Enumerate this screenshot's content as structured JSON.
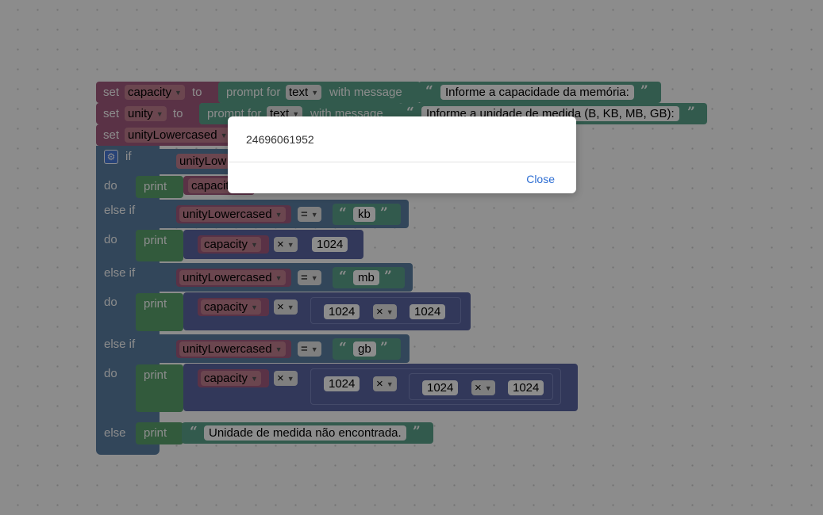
{
  "blocks": {
    "set_kw": "set",
    "to_kw": "to",
    "prompt_for": "prompt for",
    "with_message": "with message",
    "text_type": "text",
    "var_capacity": "capacity",
    "var_unity": "unity",
    "var_unity_lower": "unityLowercased",
    "msg_capacity": "Informe a capacidade da memória:",
    "msg_unity": "Informe a unidade de medida (B, KB, MB, GB):",
    "if_kw": "if",
    "do_kw": "do",
    "else_if_kw": "else if",
    "else_kw": "else",
    "print_kw": "print",
    "eq_op": "=",
    "mul_op": "×",
    "str_kb": "kb",
    "str_mb": "mb",
    "str_gb": "gb",
    "num_1024": "1024",
    "not_found_msg": "Unidade de medida não encontrada.",
    "partial_var1": "unityLow",
    "partial_var2": "capacit",
    "open_quote": "“",
    "close_quote": "”",
    "gear_glyph": "⚙"
  },
  "dialog": {
    "message": "24696061952",
    "close_label": "Close"
  },
  "colors": {
    "variable": "#a55b80",
    "text": "#5ba58c",
    "control": "#5b80a5",
    "math": "#5b67a5",
    "link": "#2f6fd3"
  }
}
